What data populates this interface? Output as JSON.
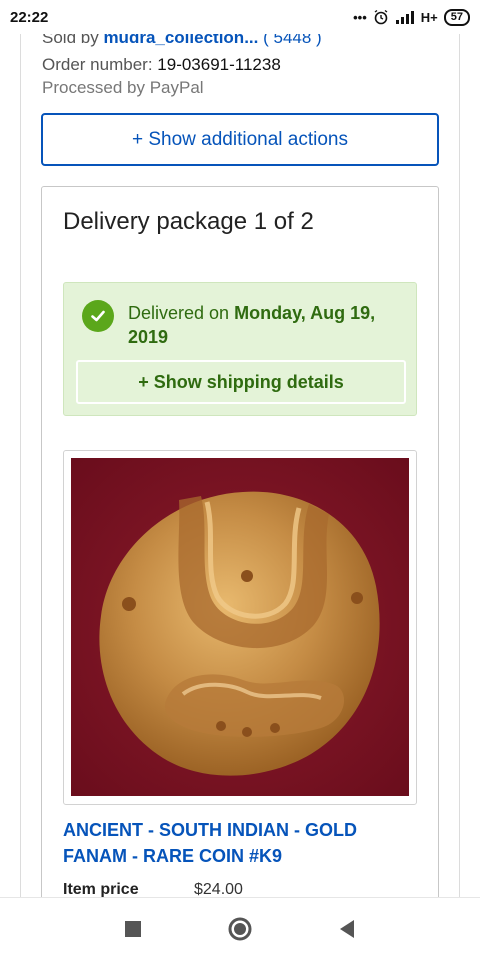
{
  "status_bar": {
    "time": "22:22",
    "signal_text": "H+",
    "battery": "57",
    "icons": [
      "more-dots-icon",
      "alarm-icon",
      "signal-icon",
      "battery-icon"
    ]
  },
  "order": {
    "sold_by_prefix": "Sold by",
    "seller_name": "mudra_collection...",
    "feedback_score": "( 5448 )",
    "order_number_label": "Order number:",
    "order_number_value": "19-03691-11238",
    "processed_by": "Processed by PayPal"
  },
  "actions": {
    "show_additional_label": "+ Show additional actions"
  },
  "package": {
    "title": "Delivery package 1 of 2",
    "delivered_prefix": "Delivered on",
    "delivered_date": "Monday, Aug 19, 2019",
    "shipping_details_label": "+ Show shipping details"
  },
  "item": {
    "title": "ANCIENT - SOUTH INDIAN - GOLD FANAM - RARE COIN #K9",
    "price_label": "Item price",
    "price_value": "$24.00"
  },
  "colors": {
    "link_blue": "#0654ba",
    "delivered_bg": "#e4f3d8",
    "delivered_green": "#5ba71b"
  },
  "nav": {
    "icons": [
      "recents-square-icon",
      "home-circle-icon",
      "back-triangle-icon"
    ]
  }
}
